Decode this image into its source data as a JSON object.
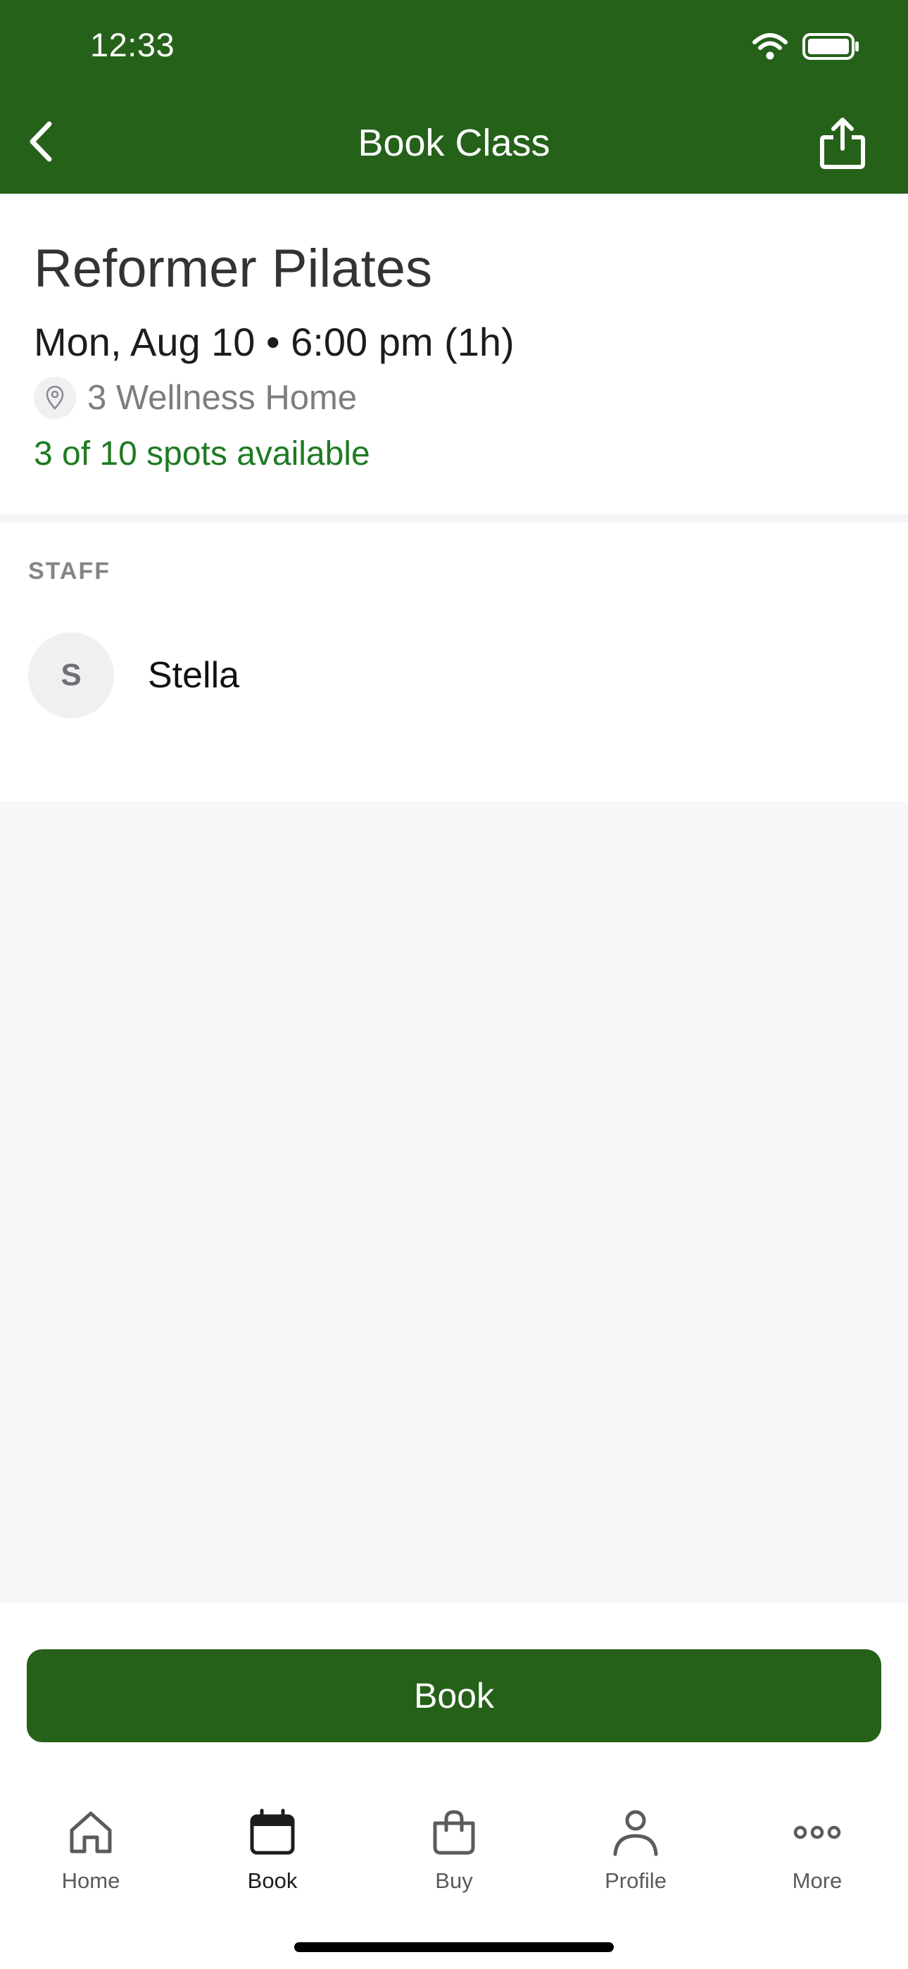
{
  "status_bar": {
    "time": "12:33"
  },
  "nav": {
    "title": "Book Class",
    "back_icon": "chevron-left-icon",
    "share_icon": "share-icon"
  },
  "class": {
    "title": "Reformer Pilates",
    "datetime": "Mon, Aug 10 • 6:00 pm (1h)",
    "location": "3 Wellness Home",
    "spots": "3 of 10 spots available"
  },
  "staff": {
    "heading": "STAFF",
    "members": [
      {
        "initial": "S",
        "name": "Stella"
      }
    ]
  },
  "book_button": {
    "label": "Book"
  },
  "tabs": [
    {
      "label": "Home",
      "icon": "home-icon",
      "active": false
    },
    {
      "label": "Book",
      "icon": "calendar-icon",
      "active": true
    },
    {
      "label": "Buy",
      "icon": "shopping-bag-icon",
      "active": false
    },
    {
      "label": "Profile",
      "icon": "person-icon",
      "active": false
    },
    {
      "label": "More",
      "icon": "more-icon",
      "active": false
    }
  ],
  "colors": {
    "brand_green": "#26611a",
    "spots_green": "#1f7a22",
    "empty_bg": "#f6f7f9"
  }
}
